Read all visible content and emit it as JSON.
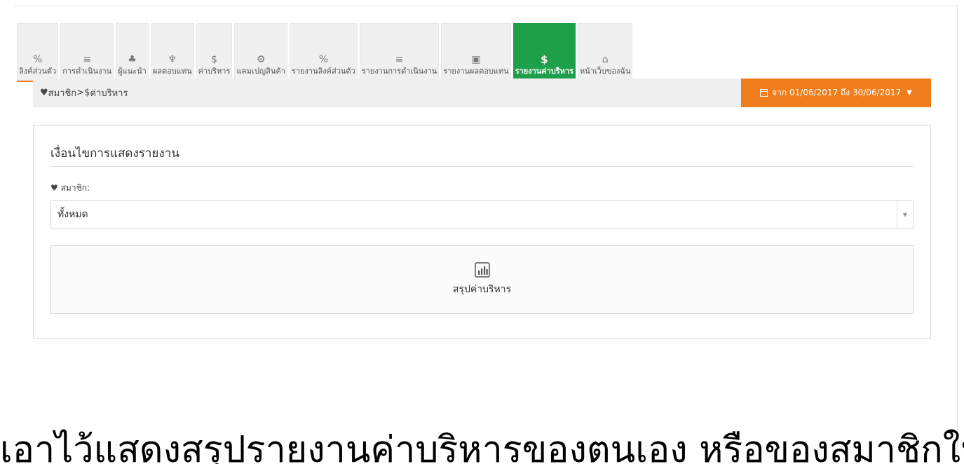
{
  "tabs": [
    {
      "icon": "%",
      "icon_name": "percent-icon",
      "label": "ลิงค์ส่วนตัว",
      "active": false
    },
    {
      "icon": "≡",
      "icon_name": "list-icon",
      "label": "การดำเนินงาน",
      "active": false
    },
    {
      "icon": "♣",
      "icon_name": "sitemap-icon",
      "label": "ผู้แนะนำ",
      "active": false
    },
    {
      "icon": "♆",
      "icon_name": "trophy-icon",
      "label": "ผลตอบแทน",
      "active": false
    },
    {
      "icon": "$",
      "icon_name": "dollar-icon",
      "label": "ค่าบริหาร",
      "active": false
    },
    {
      "icon": "⚙",
      "icon_name": "gift-icon",
      "label": "แคมเปญสินค้า",
      "active": false
    },
    {
      "icon": "%",
      "icon_name": "percent-icon",
      "label": "รายงานลิงค์ส่วนตัว",
      "active": false
    },
    {
      "icon": "≡",
      "icon_name": "list-icon",
      "label": "รายงานการดำเนินงาน",
      "active": false
    },
    {
      "icon": "▣",
      "icon_name": "money-icon",
      "label": "รายงานผลตอบแทน",
      "active": false
    },
    {
      "icon": "$",
      "icon_name": "dollar-icon",
      "label": "รายงานค่าบริหาร",
      "active": true
    },
    {
      "icon": "⌂",
      "icon_name": "home-icon",
      "label": "หน้าเว็บของฉัน",
      "active": false
    }
  ],
  "breadcrumb": {
    "home_label": "สมาชิก",
    "separator": ">",
    "current_icon": "$",
    "current_label": "ค่าบริหาร"
  },
  "date_range": {
    "label": "จาก 01/06/2017 ถึง 30/06/2017"
  },
  "filters": {
    "title": "เงื่อนไขการแสดงรายงาน",
    "member_label": "สมาชิก:",
    "member_value": "ทั้งหมด"
  },
  "summary": {
    "label": "สรุปค่าบริหาร"
  },
  "caption": {
    "text": "เอาไว้แสดงสรุปรายงานค่าบริหารของตนเอง หรือของสมาชิกในโครงสร้าง"
  },
  "colors": {
    "accent_orange": "#f07d1c",
    "active_green": "#1ea04a"
  }
}
